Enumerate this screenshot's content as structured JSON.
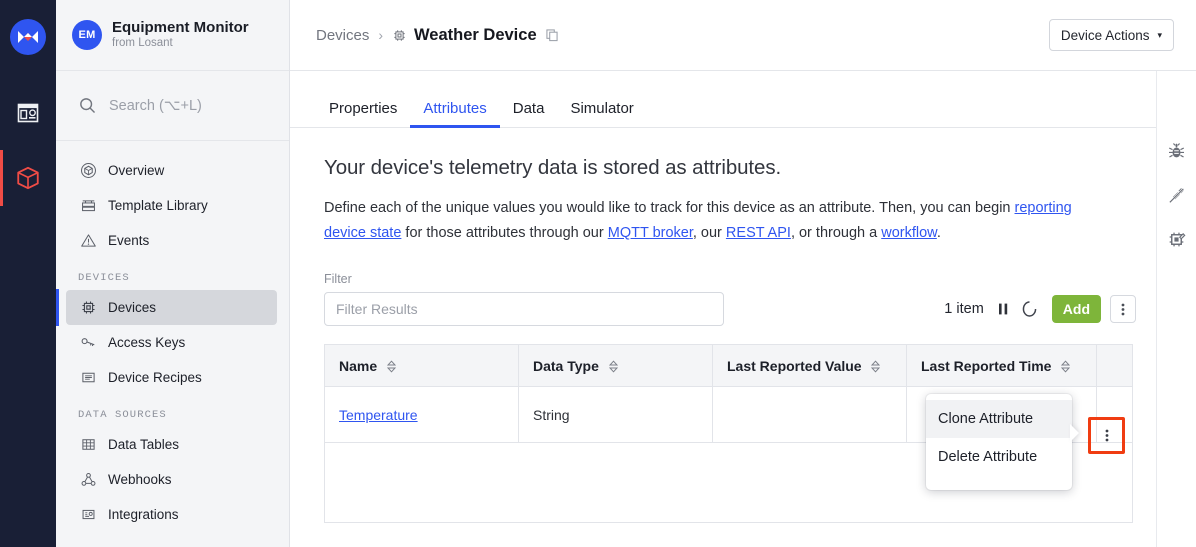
{
  "brand": {
    "logo_icon": "losant-logo-icon",
    "accent_blue": "#2f55f0",
    "accent_red": "#f04c46",
    "accent_green": "#7eb53a",
    "highlight_red": "#f03c11"
  },
  "rail": {
    "items": [
      {
        "name": "dashboards-icon",
        "label": "Dashboards",
        "active": false
      },
      {
        "name": "applications-icon",
        "label": "Applications",
        "active": true
      }
    ]
  },
  "sidebar": {
    "org": {
      "avatar_initials": "EM",
      "name": "Equipment Monitor",
      "subtitle": "from Losant"
    },
    "search": {
      "icon": "search-icon",
      "placeholder": "Search (⌥+L)"
    },
    "nav": [
      {
        "icon": "overview-icon",
        "label": "Overview",
        "active": false
      },
      {
        "icon": "template-icon",
        "label": "Template Library",
        "active": false
      },
      {
        "icon": "warning-icon",
        "label": "Events",
        "active": false
      }
    ],
    "group_devices_label": "DEVICES",
    "nav_devices": [
      {
        "icon": "device-chip-icon",
        "label": "Devices",
        "active": true
      },
      {
        "icon": "key-icon",
        "label": "Access Keys",
        "active": false
      },
      {
        "icon": "recipe-icon",
        "label": "Device Recipes",
        "active": false
      }
    ],
    "group_data_label": "DATA SOURCES",
    "nav_data": [
      {
        "icon": "table-icon",
        "label": "Data Tables",
        "active": false
      },
      {
        "icon": "webhook-icon",
        "label": "Webhooks",
        "active": false
      },
      {
        "icon": "integrations-icon",
        "label": "Integrations",
        "active": false
      }
    ]
  },
  "topbar": {
    "breadcrumb_parent": "Devices",
    "breadcrumb_sep": "›",
    "breadcrumb_icon": "device-chip-icon",
    "breadcrumb_current": "Weather Device",
    "copy_icon": "copy-icon",
    "device_actions_label": "Device Actions",
    "device_actions_caret": "▾"
  },
  "tabs": [
    {
      "label": "Properties",
      "active": false
    },
    {
      "label": "Attributes",
      "active": true
    },
    {
      "label": "Data",
      "active": false
    },
    {
      "label": "Simulator",
      "active": false
    }
  ],
  "page": {
    "heading": "Your device's telemetry data is stored as attributes.",
    "body_part1": "Define each of the unique values you would like to track for this device as an attribute. Then, you can begin ",
    "link_reporting": "reporting device state",
    "body_part2": " for those attributes through our ",
    "link_mqtt": "MQTT broker",
    "body_part3": ", our ",
    "link_rest": "REST API",
    "body_part4": ", or through a ",
    "link_workflow": "workflow",
    "body_part5": "."
  },
  "filter": {
    "label": "Filter",
    "placeholder": "Filter Results",
    "value": ""
  },
  "toolbar": {
    "item_count": "1 item",
    "pause_icon": "pause-icon",
    "refresh_icon": "spinner-icon",
    "add_label": "Add",
    "kebab_icon": "kebab-menu-icon"
  },
  "table": {
    "columns": [
      {
        "label": "Name",
        "sort_icon": "sort-icon"
      },
      {
        "label": "Data Type",
        "sort_icon": "sort-icon"
      },
      {
        "label": "Last Reported Value",
        "sort_icon": "sort-icon"
      },
      {
        "label": "Last Reported Time",
        "sort_icon": "sort-icon"
      }
    ],
    "rows": [
      {
        "name": "Temperature",
        "data_type": "String",
        "last_reported_value": "",
        "last_reported_time": "",
        "row_kebab_icon": "kebab-menu-icon"
      }
    ]
  },
  "context_menu": {
    "items": [
      {
        "label": "Clone Attribute",
        "hover": true
      },
      {
        "label": "Delete Attribute",
        "hover": false
      }
    ]
  },
  "right_rail": [
    {
      "icon": "bug-icon",
      "label": "Debug"
    },
    {
      "icon": "plug-off-icon",
      "label": "Connection Status"
    },
    {
      "icon": "device-edit-icon",
      "label": "Device Settings"
    }
  ]
}
